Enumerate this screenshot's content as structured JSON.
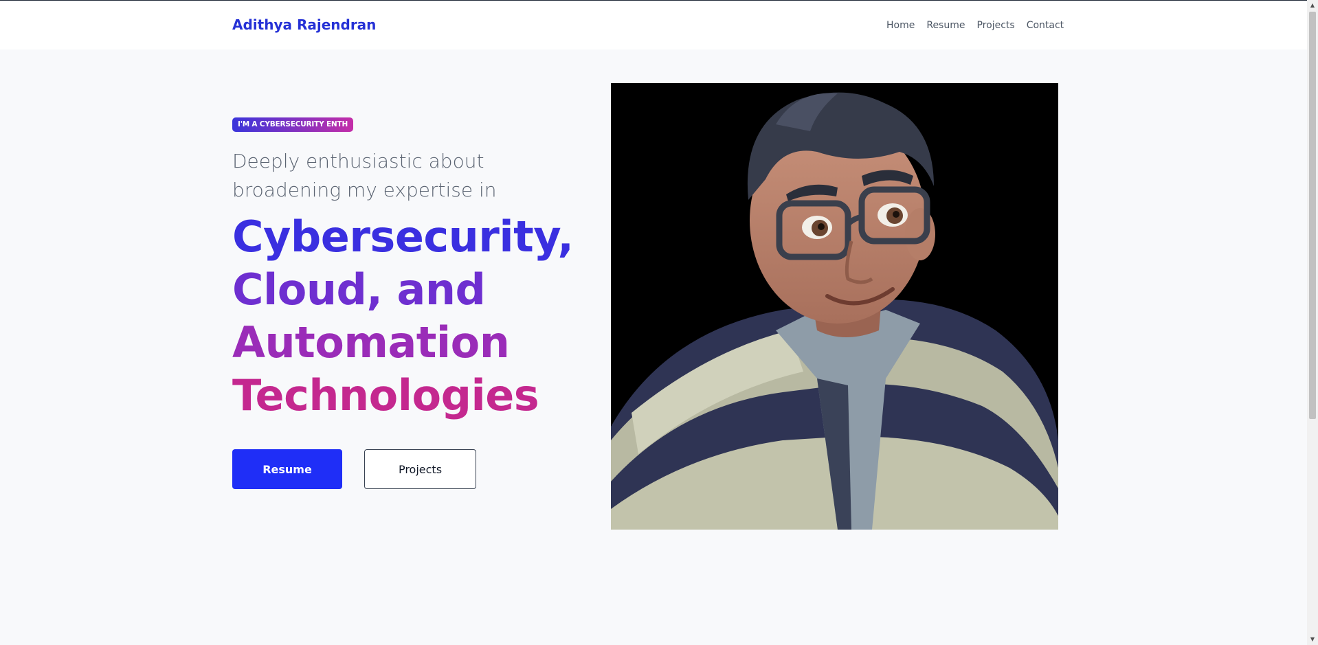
{
  "header": {
    "brand": "Adithya Rajendran",
    "nav": [
      {
        "label": "Home"
      },
      {
        "label": "Resume"
      },
      {
        "label": "Projects"
      },
      {
        "label": "Contact"
      }
    ]
  },
  "hero": {
    "badge": "I'M A CYBERSECURITY ENTH",
    "intro": "Deeply enthusiastic about broadening my expertise in",
    "headline_lines": [
      "Cybersecurity,",
      "Cloud, and",
      "Automation",
      "Technologies"
    ],
    "buttons": {
      "primary": "Resume",
      "secondary": "Projects"
    }
  },
  "portrait": {
    "icon": "avatar-portrait-image"
  },
  "scrollbar": {
    "up_icon": "triangle-up-icon",
    "down_icon": "triangle-down-icon"
  },
  "colors": {
    "brand": "#2531d6",
    "primary_button": "#1f2ef7",
    "gradient_start": "#3a2fe0",
    "gradient_end": "#c4288f"
  }
}
